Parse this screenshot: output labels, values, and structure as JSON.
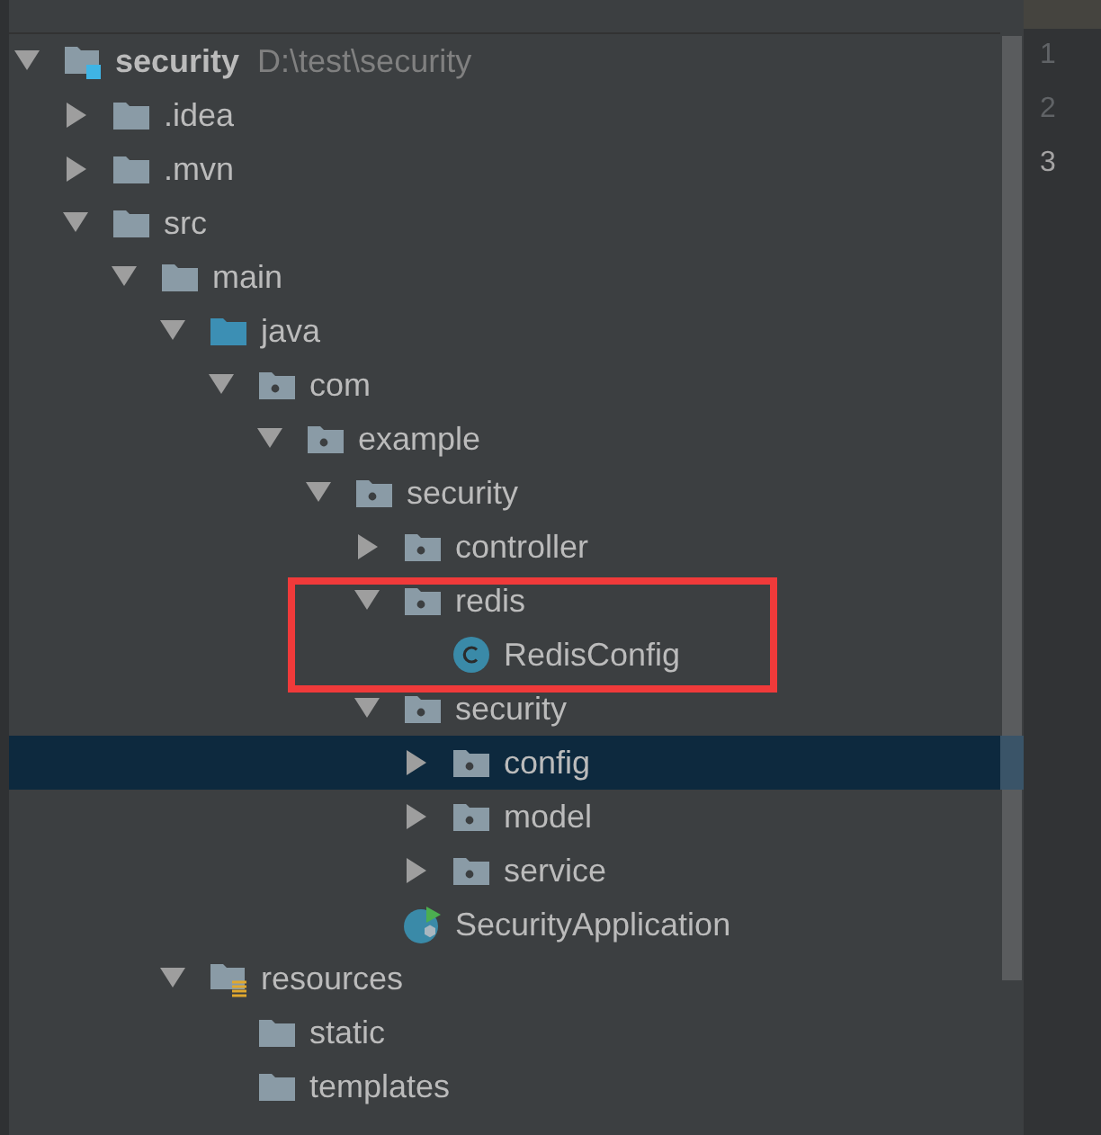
{
  "project_tree": {
    "items": [
      {
        "label": "security",
        "path": "D:\\test\\security",
        "kind": "module",
        "expanded": true,
        "selected": false,
        "children": [
          {
            "label": ".idea",
            "kind": "folder",
            "expanded": false,
            "selected": false
          },
          {
            "label": ".mvn",
            "kind": "folder",
            "expanded": false,
            "selected": false
          },
          {
            "label": "src",
            "kind": "folder",
            "expanded": true,
            "selected": false,
            "children": [
              {
                "label": "main",
                "kind": "folder",
                "expanded": true,
                "selected": false,
                "children": [
                  {
                    "label": "java",
                    "kind": "source-folder",
                    "expanded": true,
                    "selected": false,
                    "children": [
                      {
                        "label": "com",
                        "kind": "package",
                        "expanded": true,
                        "selected": false,
                        "children": [
                          {
                            "label": "example",
                            "kind": "package",
                            "expanded": true,
                            "selected": false,
                            "children": [
                              {
                                "label": "security",
                                "kind": "package",
                                "expanded": true,
                                "selected": false,
                                "children": [
                                  {
                                    "label": "controller",
                                    "kind": "package",
                                    "expanded": false,
                                    "selected": false
                                  },
                                  {
                                    "label": "redis",
                                    "kind": "package",
                                    "expanded": true,
                                    "selected": false,
                                    "boxed": true,
                                    "children": [
                                      {
                                        "label": "RedisConfig",
                                        "kind": "class",
                                        "selected": false
                                      }
                                    ]
                                  },
                                  {
                                    "label": "security",
                                    "kind": "package",
                                    "expanded": true,
                                    "selected": false,
                                    "children": [
                                      {
                                        "label": "config",
                                        "kind": "package",
                                        "expanded": false,
                                        "selected": true
                                      },
                                      {
                                        "label": "model",
                                        "kind": "package",
                                        "expanded": false,
                                        "selected": false
                                      },
                                      {
                                        "label": "service",
                                        "kind": "package",
                                        "expanded": false,
                                        "selected": false
                                      }
                                    ]
                                  },
                                  {
                                    "label": "SecurityApplication",
                                    "kind": "spring-class",
                                    "selected": false
                                  }
                                ]
                              }
                            ]
                          }
                        ]
                      }
                    ]
                  },
                  {
                    "label": "resources",
                    "kind": "resources-folder",
                    "expanded": true,
                    "selected": false,
                    "children": [
                      {
                        "label": "static",
                        "kind": "folder",
                        "selected": false
                      },
                      {
                        "label": "templates",
                        "kind": "folder",
                        "selected": false
                      }
                    ]
                  }
                ]
              }
            ]
          }
        ]
      }
    ]
  },
  "editor": {
    "line_numbers": [
      {
        "text": "1",
        "current": false
      },
      {
        "text": "2",
        "current": false
      },
      {
        "text": "3",
        "current": true
      }
    ]
  }
}
